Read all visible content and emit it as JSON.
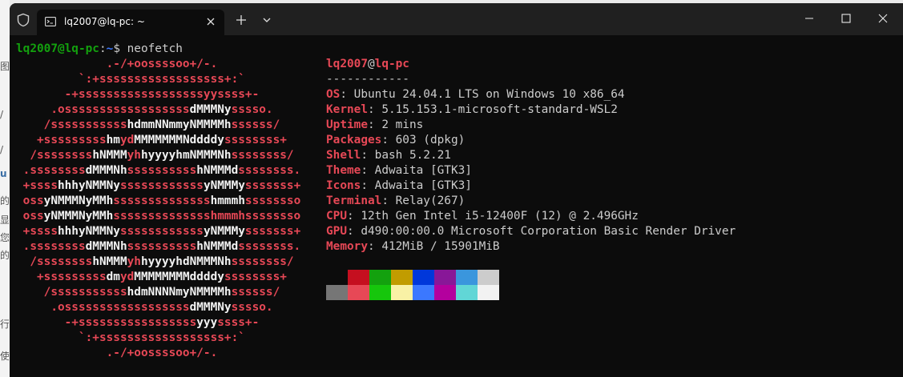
{
  "window": {
    "tab_title": "lq2007@lq-pc: ~"
  },
  "background_fragments": [
    "图",
    "/",
    "/",
    "u",
    "的",
    "显",
    "您",
    "的",
    "行",
    "使"
  ],
  "prompt": {
    "user": "lq2007@lq-pc",
    "colon": ":",
    "path": "~",
    "dollar": "$ ",
    "command": "neofetch"
  },
  "logo": [
    [
      {
        "c": "r",
        "t": "             .-/+oossssoo+/-."
      }
    ],
    [
      {
        "c": "r",
        "t": "         `:+ssssssssssssssssss+:`"
      }
    ],
    [
      {
        "c": "r",
        "t": "       -+ssssssssssssssssssyyssss+-"
      }
    ],
    [
      {
        "c": "r",
        "t": "     .ossssssssssssssssss"
      },
      {
        "c": "w",
        "t": "dMMMNy"
      },
      {
        "c": "r",
        "t": "sssso."
      }
    ],
    [
      {
        "c": "r",
        "t": "    /sssssssssss"
      },
      {
        "c": "w",
        "t": "hdmmNNmmyNMMMMh"
      },
      {
        "c": "r",
        "t": "ssssss/"
      }
    ],
    [
      {
        "c": "r",
        "t": "   +sssssssss"
      },
      {
        "c": "w",
        "t": "hm"
      },
      {
        "c": "r",
        "t": "yd"
      },
      {
        "c": "w",
        "t": "MMMMMMMNddddy"
      },
      {
        "c": "r",
        "t": "ssssssss+"
      }
    ],
    [
      {
        "c": "r",
        "t": "  /ssssssss"
      },
      {
        "c": "w",
        "t": "hNMMM"
      },
      {
        "c": "r",
        "t": "yh"
      },
      {
        "c": "w",
        "t": "hyyyyhmNMMMNh"
      },
      {
        "c": "r",
        "t": "ssssssss/"
      }
    ],
    [
      {
        "c": "r",
        "t": " .ssssssss"
      },
      {
        "c": "w",
        "t": "dMMMNh"
      },
      {
        "c": "r",
        "t": "ssssssssss"
      },
      {
        "c": "w",
        "t": "hNMMMd"
      },
      {
        "c": "r",
        "t": "ssssssss."
      }
    ],
    [
      {
        "c": "r",
        "t": " +ssss"
      },
      {
        "c": "w",
        "t": "hhhyNMMNy"
      },
      {
        "c": "r",
        "t": "ssssssssssss"
      },
      {
        "c": "w",
        "t": "yNMMMy"
      },
      {
        "c": "r",
        "t": "sssssss+"
      }
    ],
    [
      {
        "c": "r",
        "t": " oss"
      },
      {
        "c": "w",
        "t": "yNMMMNyMMh"
      },
      {
        "c": "r",
        "t": "ssssssssssssss"
      },
      {
        "c": "w",
        "t": "hmmmh"
      },
      {
        "c": "r",
        "t": "ssssssso"
      }
    ],
    [
      {
        "c": "r",
        "t": " oss"
      },
      {
        "c": "w",
        "t": "yNMMMNyMMh"
      },
      {
        "c": "r",
        "t": "sssssssssssssshmmmhssssssso"
      }
    ],
    [
      {
        "c": "r",
        "t": " +ssss"
      },
      {
        "c": "w",
        "t": "hhhyNMMNy"
      },
      {
        "c": "r",
        "t": "ssssssssssss"
      },
      {
        "c": "w",
        "t": "yNMMMy"
      },
      {
        "c": "r",
        "t": "sssssss+"
      }
    ],
    [
      {
        "c": "r",
        "t": " .ssssssss"
      },
      {
        "c": "w",
        "t": "dMMMNh"
      },
      {
        "c": "r",
        "t": "ssssssssss"
      },
      {
        "c": "w",
        "t": "hNMMMd"
      },
      {
        "c": "r",
        "t": "ssssssss."
      }
    ],
    [
      {
        "c": "r",
        "t": "  /ssssssss"
      },
      {
        "c": "w",
        "t": "hNMMM"
      },
      {
        "c": "r",
        "t": "yh"
      },
      {
        "c": "w",
        "t": "hyyyyhdNMMMNh"
      },
      {
        "c": "r",
        "t": "ssssssss/"
      }
    ],
    [
      {
        "c": "r",
        "t": "   +sssssssss"
      },
      {
        "c": "w",
        "t": "dm"
      },
      {
        "c": "r",
        "t": "yd"
      },
      {
        "c": "w",
        "t": "MMMMMMMMddddy"
      },
      {
        "c": "r",
        "t": "ssssssss+"
      }
    ],
    [
      {
        "c": "r",
        "t": "    /sssssssssss"
      },
      {
        "c": "w",
        "t": "hdmNNNNmyNMMMMh"
      },
      {
        "c": "r",
        "t": "ssssss/"
      }
    ],
    [
      {
        "c": "r",
        "t": "     .ossssssssssssssssss"
      },
      {
        "c": "w",
        "t": "dMMMNy"
      },
      {
        "c": "r",
        "t": "sssso."
      }
    ],
    [
      {
        "c": "r",
        "t": "       -+sssssssssssssssss"
      },
      {
        "c": "w",
        "t": "yyy"
      },
      {
        "c": "r",
        "t": "ssss+-"
      }
    ],
    [
      {
        "c": "r",
        "t": "         `:+ssssssssssssssssss+:`"
      }
    ],
    [
      {
        "c": "r",
        "t": "             .-/+oossssoo+/-."
      }
    ]
  ],
  "info": {
    "user": "lq2007",
    "at": "@",
    "host": "lq-pc",
    "separator": "------------",
    "fields": [
      {
        "label": "OS",
        "colon": ": ",
        "value": "Ubuntu 24.04.1 LTS on Windows 10 x86_64"
      },
      {
        "label": "Kernel",
        "colon": ": ",
        "value": "5.15.153.1-microsoft-standard-WSL2"
      },
      {
        "label": "Uptime",
        "colon": ": ",
        "value": "2 mins"
      },
      {
        "label": "Packages",
        "colon": ": ",
        "value": "603 (dpkg)"
      },
      {
        "label": "Shell",
        "colon": ": ",
        "value": "bash 5.2.21"
      },
      {
        "label": "Theme",
        "colon": ": ",
        "value": "Adwaita [GTK3]"
      },
      {
        "label": "Icons",
        "colon": ": ",
        "value": "Adwaita [GTK3]"
      },
      {
        "label": "Terminal",
        "colon": ": ",
        "value": "Relay(267)"
      },
      {
        "label": "CPU",
        "colon": ": ",
        "value": "12th Gen Intel i5-12400F (12) @ 2.496GHz"
      },
      {
        "label": "GPU",
        "colon": ": ",
        "value": "d490:00:00.0 Microsoft Corporation Basic Render Driver"
      },
      {
        "label": "Memory",
        "colon": ": ",
        "value": "412MiB / 15901MiB"
      }
    ]
  },
  "palette": {
    "row1": [
      "#0c0c0c",
      "#c50f1f",
      "#13a10e",
      "#c19c00",
      "#0037da",
      "#881798",
      "#3a96dd",
      "#cccccc"
    ],
    "row2": [
      "#767676",
      "#e74856",
      "#16c60c",
      "#f9f1a5",
      "#3b78ff",
      "#b4009e",
      "#61d6d6",
      "#f2f2f2"
    ]
  },
  "icons": {
    "shield": "shield-icon",
    "terminal": "terminal-tab-icon",
    "tab_close": "close-icon",
    "new_tab": "plus-icon",
    "dropdown": "chevron-down-icon",
    "minimize": "minimize-icon",
    "maximize": "maximize-icon",
    "close": "close-icon"
  }
}
